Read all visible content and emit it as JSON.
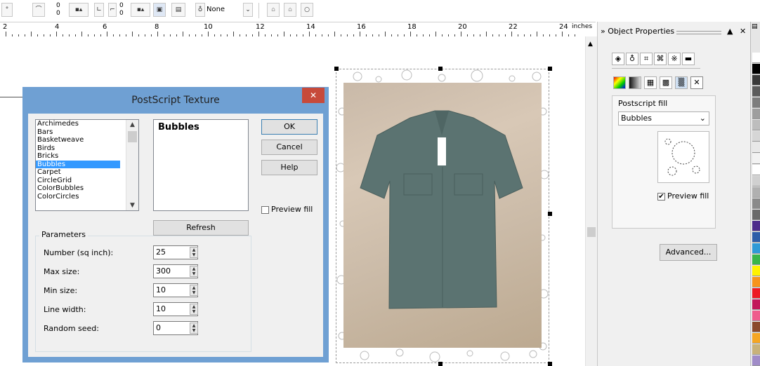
{
  "toolbar": {
    "offset_x": "0",
    "offset_y": "0",
    "offset2_x": "0",
    "offset2_y": "0",
    "outline_width": "None"
  },
  "ruler": {
    "numbers": [
      "4",
      "6",
      "8",
      "10",
      "12",
      "14",
      "16",
      "18",
      "20",
      "22",
      "24"
    ],
    "unit": "inches"
  },
  "dialog": {
    "title": "PostScript Texture",
    "close_glyph": "✕",
    "textures": [
      "Archimedes",
      "Bars",
      "Basketweave",
      "Birds",
      "Bricks",
      "Bubbles",
      "Carpet",
      "CircleGrid",
      "ColorBubbles",
      "ColorCircles"
    ],
    "selected_texture": "Bubbles",
    "ok_label": "OK",
    "cancel_label": "Cancel",
    "help_label": "Help",
    "preview_fill_label": "Preview fill",
    "refresh_label": "Refresh",
    "parameters_label": "Parameters",
    "params": [
      {
        "label": "Number (sq inch):",
        "value": "25"
      },
      {
        "label": "Max size:",
        "value": "300"
      },
      {
        "label": "Min size:",
        "value": "10"
      },
      {
        "label": "Line width:",
        "value": "10"
      },
      {
        "label": "Random seed:",
        "value": "0"
      }
    ]
  },
  "docker": {
    "title": "Object Properties",
    "fill_section_label": "Postscript fill",
    "fill_select": "Bubbles",
    "preview_fill_label": "Preview fill",
    "preview_checked": "✔",
    "advanced_label": "Advanced..."
  },
  "palette_colors": [
    "#ffffff",
    "#000000",
    "#3a3a3a",
    "#5c5c5c",
    "#7d7d7d",
    "#9e9e9e",
    "#bdbdbd",
    "#d6d6d6",
    "#e8e8e8",
    "#f2f2f2",
    "#ffffff",
    "#d0d0d0",
    "#b0b0b0",
    "#8a8a8a",
    "#6a6a6a",
    "#4d2b8c",
    "#2e5ea8",
    "#2f9ad6",
    "#39b54a",
    "#fff200",
    "#f7941d",
    "#ed1c24",
    "#c2185b",
    "#ef5b8c",
    "#8b4a2b",
    "#f5a623",
    "#c8b27a",
    "#a08cc8"
  ]
}
